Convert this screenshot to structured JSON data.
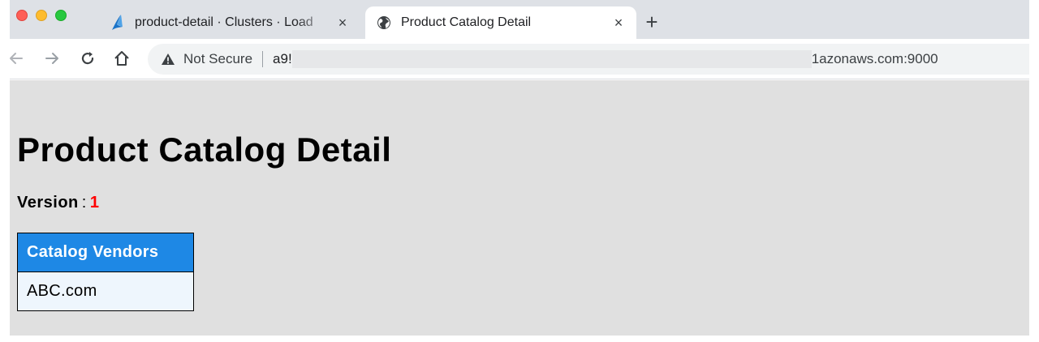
{
  "browser": {
    "tabs": [
      {
        "title": "product-detail · Clusters · Load",
        "icon": "aws-tab-icon",
        "active": false
      },
      {
        "title": "Product Catalog Detail",
        "icon": "globe-icon",
        "active": true
      }
    ],
    "new_tab_label": "+",
    "close_glyph": "×",
    "security_label": "Not Secure",
    "url_start": "a9!",
    "url_end": "1azonaws.com:9000"
  },
  "page": {
    "title": "Product Catalog Detail",
    "version_label": "Version",
    "version_separator": ":",
    "version_value": "1",
    "version_color": "#ff0000",
    "table": {
      "header": "Catalog Vendors",
      "header_color": "#1e88e5",
      "rows": [
        "ABC.com"
      ]
    }
  }
}
